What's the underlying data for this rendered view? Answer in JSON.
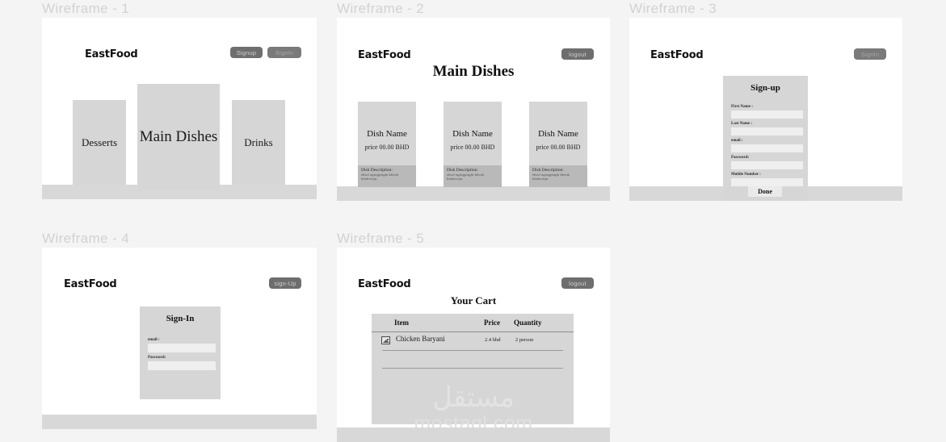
{
  "page": {
    "background_color": "#f4f4f4",
    "brand": "EastFood"
  },
  "wireframes": [
    {
      "title": "Wireframe - 1",
      "brand": "EastFood",
      "buttons": [
        {
          "label": "Signup",
          "name": "signup-button"
        },
        {
          "label": "SignIn",
          "name": "signin-button"
        }
      ],
      "categories": [
        {
          "label": "Desserts"
        },
        {
          "label": "Main Dishes"
        },
        {
          "label": "Drinks"
        }
      ]
    },
    {
      "title": "Wireframe - 2",
      "brand": "EastFood",
      "buttons": [
        {
          "label": "logout",
          "name": "logout-button"
        }
      ],
      "heading": "Main Dishes",
      "dishes": [
        {
          "name": "Dish Name",
          "price": "price 00.00 BHD",
          "desc_title": "Dish Description:",
          "desc_body": "ehsof ngnsjgnsgln kbvnb bduhvnsjn."
        },
        {
          "name": "Dish Name",
          "price": "price 00.00 BHD",
          "desc_title": "Dish Description:",
          "desc_body": "ehsof ngnsjgnsgln kbvnb bduhvnsjn."
        },
        {
          "name": "Dish Name",
          "price": "price 00.00 BHD",
          "desc_title": "Dish Description:",
          "desc_body": "ehsof ngnsjgnsgln kbvnb bduhvnsjn."
        }
      ]
    },
    {
      "title": "Wireframe - 3",
      "brand": "EastFood",
      "buttons": [
        {
          "label": "SignIn",
          "name": "signin-button"
        }
      ],
      "form": {
        "title": "Sign-up",
        "fields": [
          {
            "label": "First Name :",
            "value": ""
          },
          {
            "label": "Last Name :",
            "value": ""
          },
          {
            "label": "email :",
            "value": ""
          },
          {
            "label": "Password:",
            "value": ""
          },
          {
            "label": "Mobile Number :",
            "value": ""
          }
        ],
        "submit": "Done"
      }
    },
    {
      "title": "Wireframe - 4",
      "brand": "EastFood",
      "buttons": [
        {
          "label": "sign-Up",
          "name": "signup-button"
        }
      ],
      "form": {
        "title": "Sign-In",
        "fields": [
          {
            "label": "email :",
            "value": ""
          },
          {
            "label": "Password:",
            "value": ""
          }
        ]
      }
    },
    {
      "title": "Wireframe - 5",
      "brand": "EastFood",
      "buttons": [
        {
          "label": "logout",
          "name": "logout-button"
        }
      ],
      "heading": "Your Cart",
      "cart": {
        "columns": [
          "Item",
          "Price",
          "Quantity"
        ],
        "rows": [
          {
            "icon": "image-placeholder-icon",
            "item": "Chicken Baryani",
            "price": "2.4 bhd",
            "quantity": "2 person"
          }
        ]
      }
    }
  ],
  "watermark": {
    "arabic": "مستقل",
    "latin": "mostaql.com"
  }
}
